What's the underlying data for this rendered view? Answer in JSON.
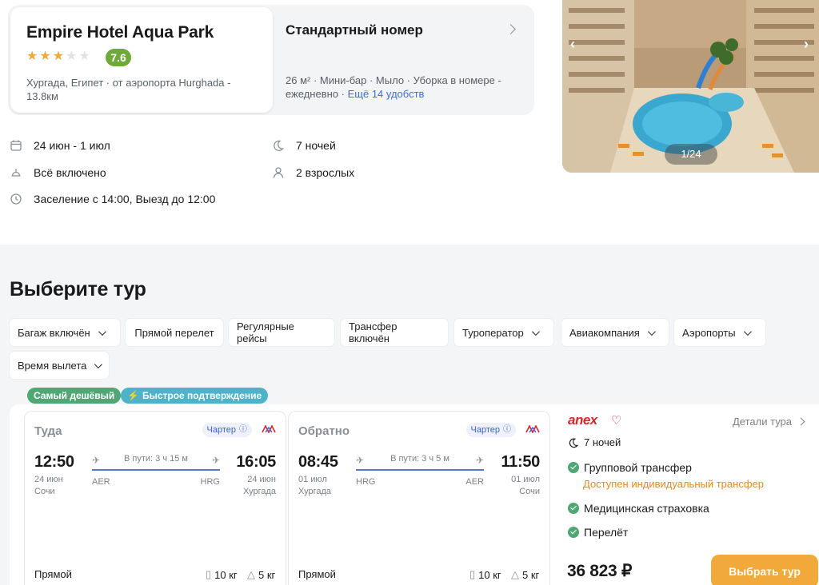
{
  "hotel": {
    "name": "Empire Hotel Aqua Park",
    "stars": 3,
    "max_stars": 5,
    "rating": "7.6",
    "location": "Хургада, Египет · от аэропорта Hurghada - 13.8км"
  },
  "room": {
    "title": "Стандартный номер",
    "amenities": "26 м² · Мини-бар · Мыло · Уборка в номере - ежедневно ·",
    "more_link": "Ещё 14 удобств"
  },
  "trip_info": {
    "dates": "24 июн - 1 июл",
    "nights": "7 ночей",
    "meal": "Всё включено",
    "guests": "2 взрослых",
    "checkin": "Заселение с 14:00, Выезд до 12:00"
  },
  "gallery": {
    "counter": "1/24",
    "prev": "‹",
    "next": "›"
  },
  "tours": {
    "title": "Выберите тур",
    "filters": [
      {
        "label": "Багаж включён",
        "dropdown": true
      },
      {
        "label": "Прямой перелет",
        "dropdown": false
      },
      {
        "label": "Регулярные рейсы",
        "dropdown": false
      },
      {
        "label": "Трансфер включён",
        "dropdown": false
      },
      {
        "label": "Туроператор",
        "dropdown": true
      },
      {
        "label": "Авиакомпания",
        "dropdown": true
      },
      {
        "label": "Аэропорты",
        "dropdown": true
      },
      {
        "label": "Время вылета",
        "dropdown": true
      }
    ],
    "badges": {
      "cheapest": "Самый дешёвый",
      "fast": "Быстрое подтверждение"
    }
  },
  "offer": {
    "outbound": {
      "title": "Туда",
      "type": "Чартер",
      "dep_time": "12:50",
      "dep_date": "24 июн",
      "dep_city": "Сочи",
      "dep_code": "AER",
      "arr_time": "16:05",
      "arr_date": "24 июн",
      "arr_city": "Хургада",
      "arr_code": "HRG",
      "duration": "В пути: 3 ч 15 м",
      "stops": "Прямой",
      "baggage": "10 кг",
      "hand": "5 кг"
    },
    "return": {
      "title": "Обратно",
      "type": "Чартер",
      "dep_time": "08:45",
      "dep_date": "01 июл",
      "dep_city": "Хургада",
      "dep_code": "HRG",
      "arr_time": "11:50",
      "arr_date": "01 июл",
      "arr_city": "Сочи",
      "arr_code": "AER",
      "duration": "В пути: 3 ч 5 м",
      "stops": "Прямой",
      "baggage": "10 кг",
      "hand": "5 кг"
    },
    "operator": "anex",
    "details_link": "Детали тура",
    "nights": "7 ночей",
    "features": [
      "Групповой трансфер",
      "Медицинская страховка",
      "Перелёт"
    ],
    "transfer_note": "Доступен индивидуальный трансфер",
    "price": "36 823 ₽",
    "button": "Выбрать тур"
  },
  "colors": {
    "accent": "#f2a93b",
    "green": "#4fa873",
    "link": "#3d6fd6",
    "operator": "#d6262f"
  }
}
